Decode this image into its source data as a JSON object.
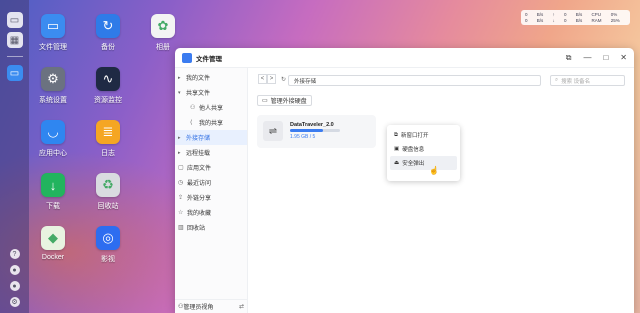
{
  "desktop": {
    "icons": [
      {
        "label": "文件管理",
        "name": "file-manager-app",
        "glyph": "▭",
        "color": "#3b8cf0"
      },
      {
        "label": "备份",
        "name": "backup-app",
        "glyph": "↻",
        "color": "#2f7be8"
      },
      {
        "label": "相册",
        "name": "photos-app",
        "glyph": "✿",
        "color": "#f3f3f3"
      },
      {
        "label": "系统设置",
        "name": "settings-app",
        "glyph": "⚙",
        "color": "#6b7280"
      },
      {
        "label": "资源监控",
        "name": "resource-monitor-app",
        "glyph": "∿",
        "color": "#1f2a44"
      },
      {
        "label": "应用中心",
        "name": "app-center-app",
        "glyph": "◡",
        "color": "#2f86f0"
      },
      {
        "label": "日志",
        "name": "logs-app",
        "glyph": "≣",
        "color": "#f5a623"
      },
      {
        "label": "下载",
        "name": "download-app",
        "glyph": "↓",
        "color": "#22b45e"
      },
      {
        "label": "回收站",
        "name": "recycle-bin-app",
        "glyph": "♻",
        "color": "#d9dbe0"
      },
      {
        "label": "Docker",
        "name": "docker-app",
        "glyph": "◆",
        "color": "#e8f3e0"
      },
      {
        "label": "影视",
        "name": "video-app",
        "glyph": "◎",
        "color": "#2d6df0"
      }
    ]
  },
  "widget": {
    "cells": [
      "0",
      "B/s",
      "↑",
      "0",
      "B/s",
      "CPU",
      "0%",
      "0",
      "B/s",
      "↓",
      "0",
      "B/s",
      "RAM",
      "25%"
    ]
  },
  "window": {
    "title": "文件管理",
    "controls": [
      "⧉",
      "—",
      "□",
      "✕"
    ]
  },
  "sidebar": {
    "items": [
      {
        "label": "我的文件",
        "arrow": "▸",
        "icon": ""
      },
      {
        "label": "共享文件",
        "arrow": "▾",
        "icon": ""
      },
      {
        "label": "他人共享",
        "arrow": "",
        "icon": "⚇",
        "sub": true
      },
      {
        "label": "我的共享",
        "arrow": "",
        "icon": "⟨",
        "sub": true
      },
      {
        "label": "外接存储",
        "arrow": "▸",
        "icon": "",
        "active": true
      },
      {
        "label": "远程挂载",
        "arrow": "▸",
        "icon": ""
      },
      {
        "label": "应用文件",
        "arrow": "",
        "icon": "▢"
      },
      {
        "label": "最近访问",
        "arrow": "",
        "icon": "◷"
      },
      {
        "label": "外链分享",
        "arrow": "",
        "icon": "⇪"
      },
      {
        "label": "我的收藏",
        "arrow": "",
        "icon": "☆"
      },
      {
        "label": "回收站",
        "arrow": "",
        "icon": "▥"
      }
    ],
    "footer": "管理员视角"
  },
  "toolbar": {
    "back": "<",
    "forward": ">",
    "refresh": "↻",
    "path": "外接存储",
    "search_placeholder": "搜索 设备名"
  },
  "manage_button": "管理外接硬盘",
  "device": {
    "name": "DataTraveler_2.0",
    "usage": "1.95 GB / 5",
    "fill_fraction": 0.65
  },
  "context_menu": {
    "items": [
      {
        "label": "新窗口打开",
        "icon": "⧉"
      },
      {
        "label": "硬盘信息",
        "icon": "▣"
      },
      {
        "label": "安全弹出",
        "icon": "⏏"
      }
    ]
  }
}
